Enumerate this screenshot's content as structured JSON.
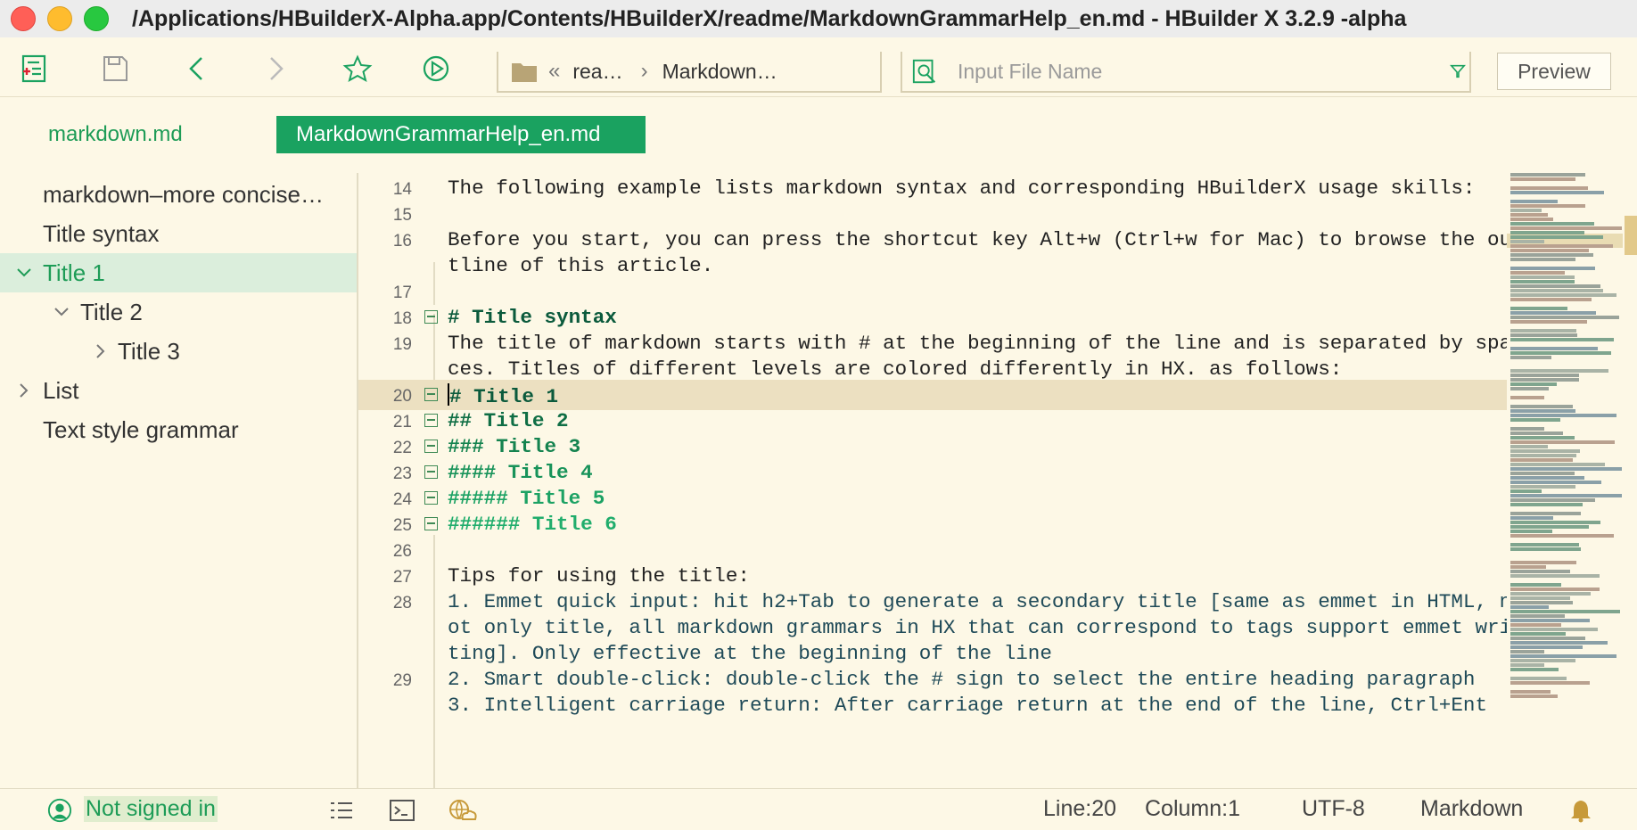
{
  "window": {
    "title": "/Applications/HBuilderX-Alpha.app/Contents/HBuilderX/readme/MarkdownGrammarHelp_en.md - HBuilder X 3.2.9 -alpha"
  },
  "toolbar": {
    "path_segments": [
      "rea…",
      "Markdown…"
    ],
    "path_overflow": "«",
    "path_separator": "›",
    "search_placeholder": "Input File Name",
    "preview_label": "Preview",
    "icons": [
      "new-file-icon",
      "save-icon",
      "back-icon",
      "forward-icon",
      "favorite-star-icon",
      "run-icon",
      "folder-icon",
      "file-search-icon",
      "filter-icon"
    ]
  },
  "tabs": [
    {
      "label": "markdown.md",
      "active": false
    },
    {
      "label": "MarkdownGrammarHelp_en.md",
      "active": true
    }
  ],
  "outline": [
    {
      "label": "markdown–more concise…",
      "chevron": "",
      "indent": 0,
      "selected": false
    },
    {
      "label": "Title syntax",
      "chevron": "",
      "indent": 0,
      "selected": false
    },
    {
      "label": "Title 1",
      "chevron": "down",
      "indent": 0,
      "selected": true
    },
    {
      "label": "Title 2",
      "chevron": "down",
      "indent": 1,
      "selected": false
    },
    {
      "label": "Title 3",
      "chevron": "right",
      "indent": 2,
      "selected": false
    },
    {
      "label": "List",
      "chevron": "right",
      "indent": 0,
      "selected": false
    },
    {
      "label": "Text style grammar",
      "chevron": "",
      "indent": 0,
      "selected": false
    }
  ],
  "editor": {
    "lines": [
      {
        "num": "14",
        "text": "The following example lists markdown syntax and corresponding HBuilderX usage skills:",
        "style": "",
        "fold": false
      },
      {
        "num": "15",
        "text": "",
        "style": "",
        "fold": false
      },
      {
        "num": "16",
        "text": "Before you start, you can press the shortcut key Alt+w (Ctrl+w for Mac) to browse the ou",
        "style": "",
        "fold": false
      },
      {
        "num": "",
        "text": "tline of this article.",
        "style": "",
        "fold": false
      },
      {
        "num": "17",
        "text": "",
        "style": "",
        "fold": false
      },
      {
        "num": "18",
        "text": "# Title syntax",
        "style": "h1",
        "fold": true
      },
      {
        "num": "19",
        "text": "The title of markdown starts with # at the beginning of the line and is separated by spa",
        "style": "",
        "fold": false
      },
      {
        "num": "",
        "text": "ces. Titles of different levels are colored differently in HX. as follows:",
        "style": "",
        "fold": false
      },
      {
        "num": "20",
        "text": "# Title 1",
        "style": "h1",
        "fold": true,
        "current": true
      },
      {
        "num": "21",
        "text": "## Title 2",
        "style": "h2",
        "fold": true
      },
      {
        "num": "22",
        "text": "### Title 3",
        "style": "h3",
        "fold": true
      },
      {
        "num": "23",
        "text": "#### Title 4",
        "style": "h4",
        "fold": true
      },
      {
        "num": "24",
        "text": "##### Title 5",
        "style": "h5",
        "fold": true
      },
      {
        "num": "25",
        "text": "###### Title 6",
        "style": "h6",
        "fold": true
      },
      {
        "num": "26",
        "text": "",
        "style": "",
        "fold": false
      },
      {
        "num": "27",
        "text": "Tips for using the title:",
        "style": "",
        "fold": false
      },
      {
        "num": "28",
        "text": "1. Emmet quick input: hit h2+Tab to generate a secondary title [same as emmet in HTML, n",
        "style": "list",
        "fold": false,
        "marker": "1."
      },
      {
        "num": "",
        "text": "ot only title, all markdown grammars in HX that can correspond to tags support emmet wri",
        "style": "list",
        "fold": false
      },
      {
        "num": "",
        "text": "ting]. Only effective at the beginning of the line",
        "style": "list",
        "fold": false
      },
      {
        "num": "29",
        "text": "2. Smart double-click: double-click the # sign to select the entire heading paragraph",
        "style": "list",
        "fold": false,
        "marker": "2."
      },
      {
        "num": "",
        "text": "3. Intelligent carriage return: After carriage return at the end of the line, Ctrl+Ent",
        "style": "list",
        "fold": false,
        "marker": "3."
      }
    ]
  },
  "statusbar": {
    "signin": "Not signed in",
    "line": "Line:20",
    "column": "Column:1",
    "encoding": "UTF-8",
    "language": "Markdown",
    "icons": [
      "user-icon",
      "outline-list-icon",
      "terminal-icon",
      "cloud-icon",
      "notification-bell-icon"
    ]
  },
  "colors": {
    "accent": "#1aa260",
    "background": "#fdf8e6",
    "current_line": "#ece0c1",
    "heading": "#0b5a3c"
  }
}
